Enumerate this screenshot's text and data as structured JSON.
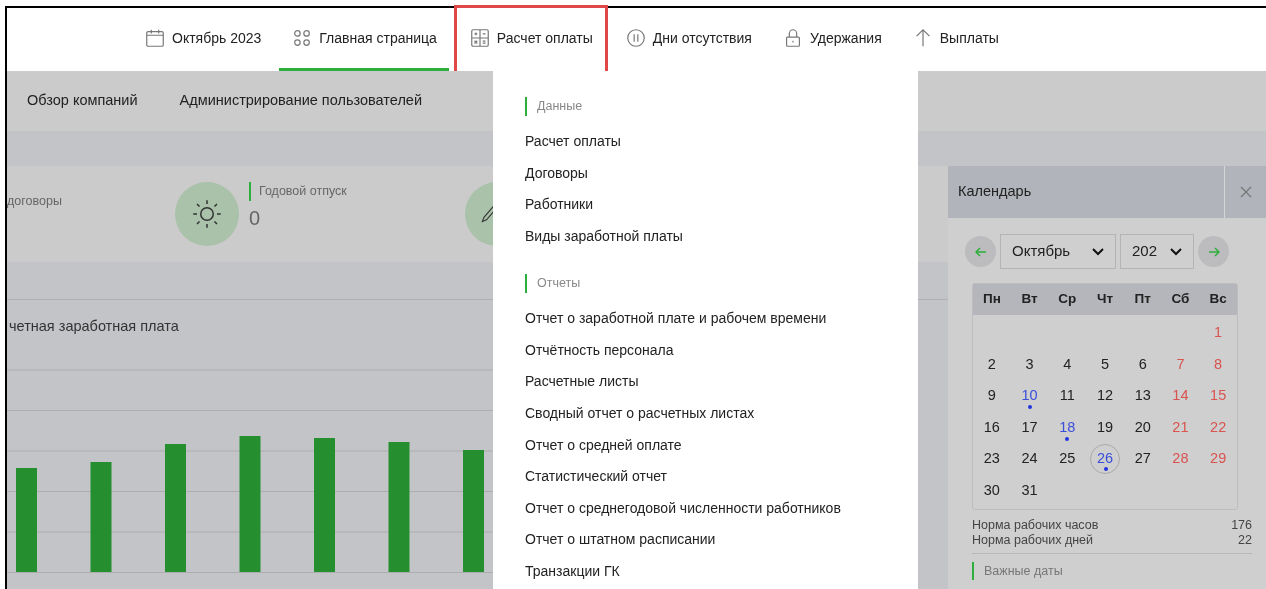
{
  "tabs": [
    {
      "label": "Октябрь 2023",
      "selected": false,
      "highlighted": false
    },
    {
      "label": "Главная страница",
      "selected": true,
      "highlighted": false
    },
    {
      "label": "Расчет оплаты",
      "selected": false,
      "highlighted": true
    },
    {
      "label": "Дни отсутствия",
      "selected": false,
      "highlighted": false
    },
    {
      "label": "Удержания",
      "selected": false,
      "highlighted": false
    },
    {
      "label": "Выплаты",
      "selected": false,
      "highlighted": false
    }
  ],
  "subnav": [
    "Обзор компаний",
    "Администрирование пользователей"
  ],
  "cards": [
    {
      "label": "договоры"
    },
    {
      "label": "Годовой отпуск",
      "value": "0"
    }
  ],
  "chart": {
    "title": "четная заработная плата"
  },
  "menu": {
    "sections": [
      {
        "title": "Данные",
        "items": [
          "Расчет оплаты",
          "Договоры",
          "Работники",
          "Виды заработной платы"
        ]
      },
      {
        "title": "Отчеты",
        "items": [
          "Отчет о заработной плате и рабочем времени",
          "Отчётность персонала",
          "Расчетные листы",
          "Сводный отчет о расчетных листах",
          "Отчет о средней оплате",
          "Статистический отчет",
          "Отчет о среднегодовой численности работников",
          "Отчет о штатном расписании",
          "Транзакции ГК"
        ]
      }
    ]
  },
  "calendar": {
    "title": "Календарь",
    "month": "Октябрь",
    "year": "202",
    "weekdays": [
      "Пн",
      "Вт",
      "Ср",
      "Чт",
      "Пт",
      "Сб",
      "Вс"
    ],
    "weeks": [
      [
        {
          "day": "1",
          "kind": "weekend",
          "today": false
        }
      ],
      [
        {
          "day": "2",
          "kind": "normal",
          "today": false
        },
        {
          "day": "3",
          "kind": "normal",
          "today": false
        },
        {
          "day": "4",
          "kind": "normal",
          "today": false
        },
        {
          "day": "5",
          "kind": "normal",
          "today": false
        },
        {
          "day": "6",
          "kind": "normal",
          "today": false
        },
        {
          "day": "7",
          "kind": "weekend",
          "today": false
        },
        {
          "day": "8",
          "kind": "weekend",
          "today": false
        }
      ],
      [
        {
          "day": "9",
          "kind": "normal",
          "today": false
        },
        {
          "day": "10",
          "kind": "event",
          "today": false
        },
        {
          "day": "11",
          "kind": "normal",
          "today": false
        },
        {
          "day": "12",
          "kind": "normal",
          "today": false
        },
        {
          "day": "13",
          "kind": "normal",
          "today": false
        },
        {
          "day": "14",
          "kind": "weekend",
          "today": false
        },
        {
          "day": "15",
          "kind": "weekend",
          "today": false
        }
      ],
      [
        {
          "day": "16",
          "kind": "normal",
          "today": false
        },
        {
          "day": "17",
          "kind": "normal",
          "today": false
        },
        {
          "day": "18",
          "kind": "event",
          "today": false
        },
        {
          "day": "19",
          "kind": "normal",
          "today": false
        },
        {
          "day": "20",
          "kind": "normal",
          "today": false
        },
        {
          "day": "21",
          "kind": "weekend",
          "today": false
        },
        {
          "day": "22",
          "kind": "weekend",
          "today": false
        }
      ],
      [
        {
          "day": "23",
          "kind": "normal",
          "today": false
        },
        {
          "day": "24",
          "kind": "normal",
          "today": false
        },
        {
          "day": "25",
          "kind": "normal",
          "today": false
        },
        {
          "day": "26",
          "kind": "event",
          "today": true
        },
        {
          "day": "27",
          "kind": "normal",
          "today": false
        },
        {
          "day": "28",
          "kind": "weekend",
          "today": false
        },
        {
          "day": "29",
          "kind": "weekend",
          "today": false
        }
      ],
      [
        {
          "day": "30",
          "kind": "normal",
          "today": false
        },
        {
          "day": "31",
          "kind": "normal",
          "today": false
        }
      ]
    ],
    "norms": [
      {
        "label": "Норма рабочих часов",
        "value": "176"
      },
      {
        "label": "Норма рабочих дней",
        "value": "22"
      }
    ],
    "important_title": "Важные даты"
  }
}
